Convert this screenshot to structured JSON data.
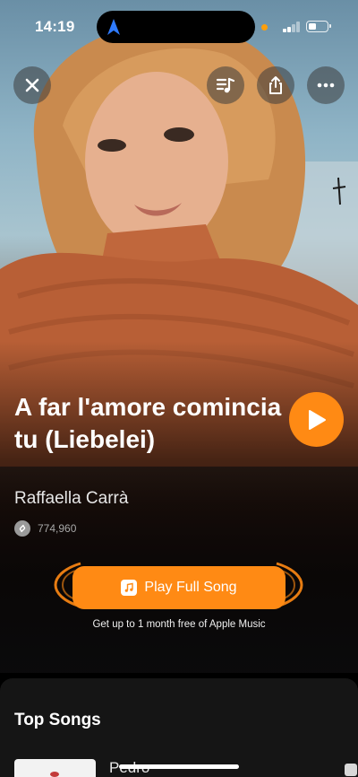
{
  "status_bar": {
    "time": "14:19",
    "icons": [
      "location-arrow-icon",
      "mic-indicator-dot",
      "signal-icon",
      "battery-icon"
    ]
  },
  "toolbar": {
    "close_icon": "close-icon",
    "lyrics_icon": "lyrics-icon",
    "share_icon": "share-icon",
    "more_icon": "more-icon"
  },
  "song": {
    "title": "A far l'amore comincia tu (Liebelei)",
    "artist": "Raffaella Carrà",
    "shazam_count": "774,960"
  },
  "actions": {
    "play_full_song_label": "Play Full Song",
    "promo_text": "Get up to 1 month free of Apple Music"
  },
  "top_songs": {
    "heading": "Top Songs",
    "items": [
      {
        "title": "Pedro"
      }
    ]
  },
  "colors": {
    "accent": "#ff8a14",
    "background": "#0b0b0c",
    "card": "#151515"
  }
}
